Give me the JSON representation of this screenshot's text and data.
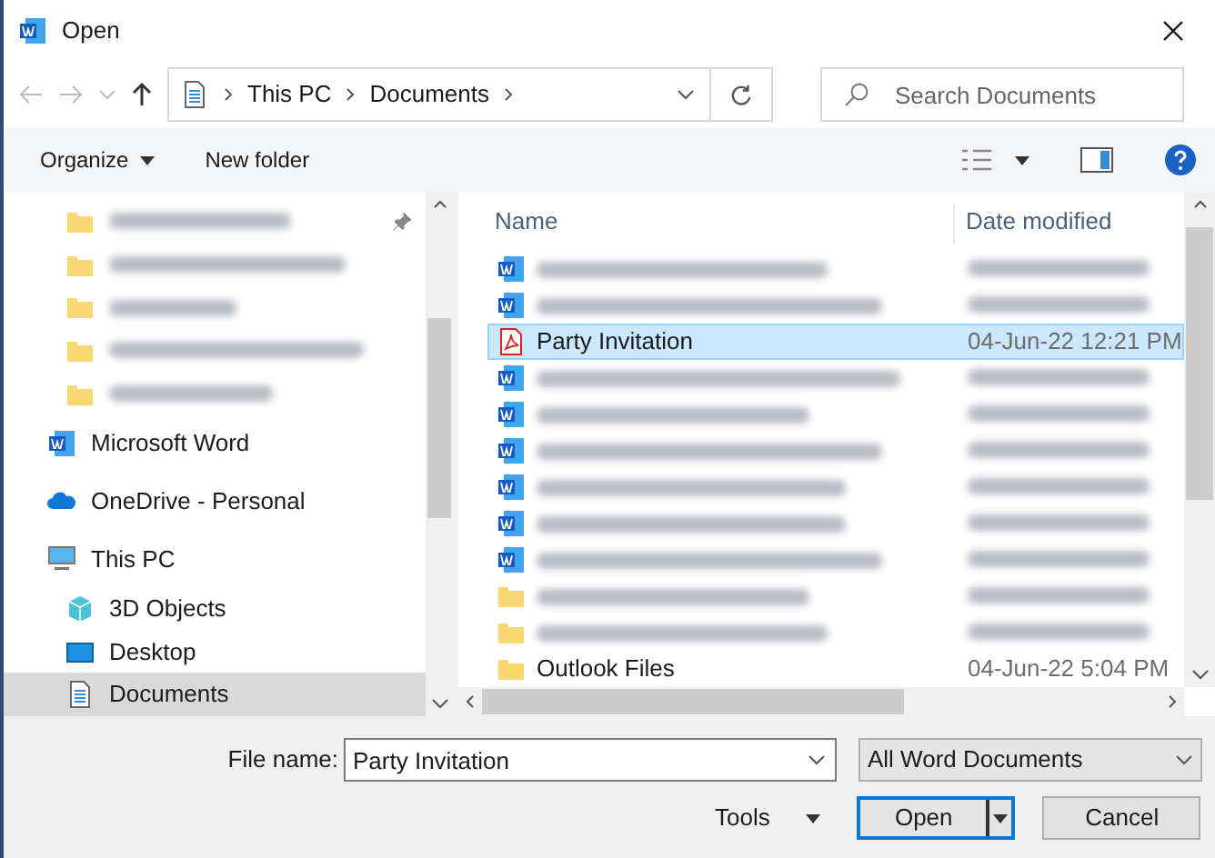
{
  "window": {
    "title": "Open"
  },
  "nav": {
    "path": [
      "This PC",
      "Documents"
    ],
    "search_placeholder": "Search Documents"
  },
  "toolbar": {
    "organize": "Organize",
    "new_folder": "New folder"
  },
  "sidebar": {
    "items": [
      {
        "kind": "blurred",
        "selected": false
      },
      {
        "kind": "blurred",
        "selected": false
      },
      {
        "kind": "blurred",
        "selected": false
      },
      {
        "kind": "blurred",
        "selected": false
      },
      {
        "kind": "blurred",
        "selected": false
      },
      {
        "kind": "top",
        "label": "Microsoft Word",
        "selected": false
      },
      {
        "kind": "top",
        "label": "OneDrive - Personal",
        "selected": false
      },
      {
        "kind": "top",
        "label": "This PC",
        "selected": false
      },
      {
        "kind": "child",
        "label": "3D Objects",
        "selected": false
      },
      {
        "kind": "child",
        "label": "Desktop",
        "selected": false
      },
      {
        "kind": "child",
        "label": "Documents",
        "selected": true
      }
    ]
  },
  "files": {
    "columns": [
      "Name",
      "Date modified"
    ],
    "rows": [
      {
        "kind": "blurreddoc",
        "selected": false
      },
      {
        "kind": "blurreddoc",
        "selected": false
      },
      {
        "kind": "pdf",
        "name": "Party Invitation",
        "date": "04-Jun-22 12:21 PM",
        "selected": true
      },
      {
        "kind": "blurreddoc",
        "selected": false
      },
      {
        "kind": "blurreddoc",
        "selected": false
      },
      {
        "kind": "blurreddoc",
        "selected": false
      },
      {
        "kind": "blurreddoc",
        "selected": false
      },
      {
        "kind": "blurreddoc",
        "selected": false
      },
      {
        "kind": "blurreddoc",
        "selected": false
      },
      {
        "kind": "blurredfolder",
        "selected": false
      },
      {
        "kind": "blurredfolder",
        "selected": false
      },
      {
        "kind": "folder",
        "name": "Outlook Files",
        "date": "04-Jun-22 5:04 PM",
        "selected": false
      }
    ]
  },
  "footer": {
    "file_name_label": "File name:",
    "file_name": "Party Invitation",
    "file_type": "All Word Documents",
    "tools": "Tools",
    "open": "Open",
    "cancel": "Cancel"
  }
}
